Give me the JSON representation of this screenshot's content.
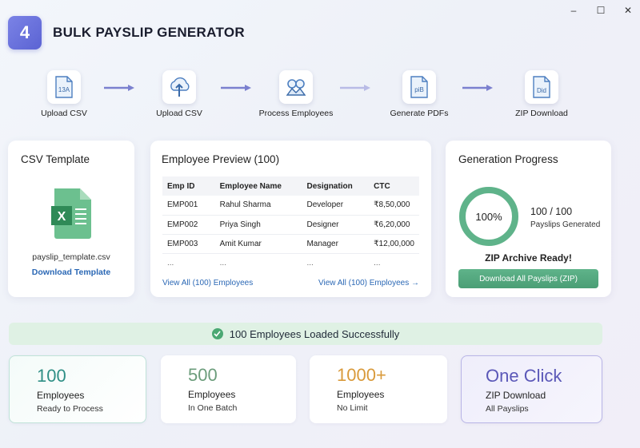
{
  "window": {
    "minimize": "–",
    "maximize": "☐",
    "close": "✕"
  },
  "header": {
    "step_number": "4",
    "title": "BULK PAYSLIP GENERATOR"
  },
  "steps": [
    {
      "label": "Upload CSV",
      "icon": "csv-file-icon",
      "icon_text": "13A"
    },
    {
      "label": "Upload CSV",
      "icon": "cloud-upload-icon"
    },
    {
      "label": "Process Employees",
      "icon": "process-gears-icon"
    },
    {
      "label": "Generate PDFs",
      "icon": "pdf-file-icon",
      "icon_text": "piB"
    },
    {
      "label": "ZIP Download",
      "icon": "zip-file-icon",
      "icon_text": "Did"
    }
  ],
  "csv_template": {
    "title": "CSV Template",
    "icon": "excel-file-icon",
    "filename": "payslip_template.csv",
    "download_label": "Download Template"
  },
  "employee_preview": {
    "title": "Employee Preview (100)",
    "columns": [
      "Emp ID",
      "Employee Name",
      "Designation",
      "CTC"
    ],
    "rows": [
      [
        "EMP001",
        "Rahul Sharma",
        "Developer",
        "₹8,50,000"
      ],
      [
        "EMP002",
        "Priya Singh",
        "Designer",
        "₹6,20,000"
      ],
      [
        "EMP003",
        "Amit Kumar",
        "Manager",
        "₹12,00,000"
      ],
      [
        "...",
        "...",
        "...",
        "..."
      ]
    ],
    "view_all_left": "View All (100) Employees",
    "view_all_right": "View All (100) Employees →"
  },
  "progress": {
    "title": "Generation Progress",
    "percent_label": "100%",
    "percent": 100,
    "count": "100 / 100",
    "count_label": "Payslips Generated",
    "zip_ready": "ZIP Archive Ready!",
    "zip_button": "Download All Payslips (ZIP)",
    "accent_color": "#5fb38a"
  },
  "banner": {
    "text": "100 Employees Loaded Successfully",
    "icon": "check-circle-icon"
  },
  "stats": [
    {
      "value": "100",
      "label": "Employees",
      "sub": "Ready to Process",
      "color": "#2f8f86"
    },
    {
      "value": "500",
      "label": "Employees",
      "sub": "In One Batch",
      "color": "#6c9d7c"
    },
    {
      "value": "1000+",
      "label": "Employees",
      "sub": "No Limit",
      "color": "#d99a3b"
    },
    {
      "value": "One Click",
      "label": "ZIP Download",
      "sub": "All Payslips",
      "color": "#5b58b8"
    }
  ]
}
